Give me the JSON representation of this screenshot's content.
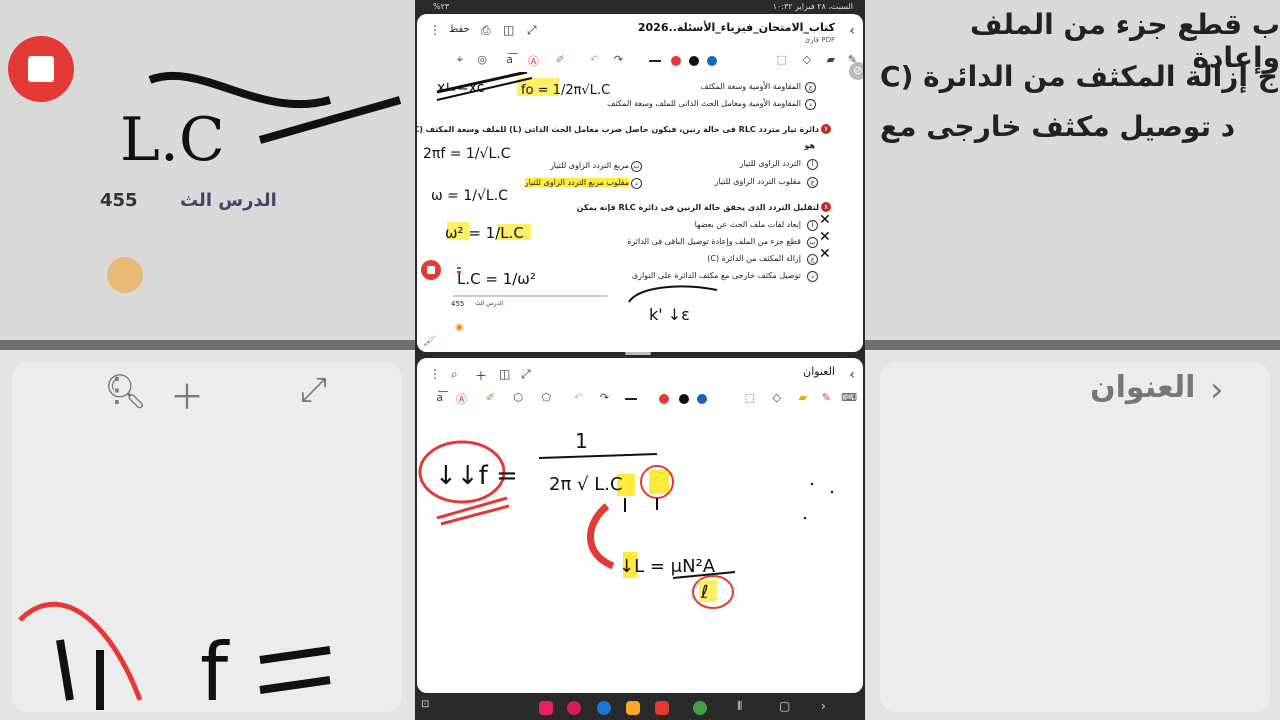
{
  "status": {
    "left": "%٢٣",
    "right": "السبت، ٢٨ فبراير ١٠:٣٢"
  },
  "top_pane": {
    "title": "كتاب_الامتحان_فيزياء_الأسئلة..2026",
    "subtitle": "قارئ PDF",
    "save_label": "حفظ"
  },
  "bottom_pane": {
    "title": "العنوان"
  },
  "doc": {
    "q6_options": [
      "المقاومة الأومية وسعة المكثف",
      "المقاومة الأومية ومعامل الحث الذاتى للملف وسعة المكثف"
    ],
    "q7_number": "٧",
    "q7_text": "دائرة تيار متردد RLC فى حالة رنين، فيكون حاصل ضرب معامل الحث الذاتى (L) للملف وسعة المكثف (C)",
    "q7_suffix": "هو",
    "q7_options": [
      "التردد الزاوى للتيار",
      "مربع التردد الزاوى للتيار",
      "مقلوب التردد الزاوى للتيار",
      "مقلوب مربع التردد الزاوى للتيار"
    ],
    "q8_number": "٨",
    "q8_text": "لتقليل التردد الذى يحقق حالة الرنين فى دائرة RLC فإنه يمكن",
    "q8_options": [
      "إبعاد لفات ملف الحث عن بعضها",
      "قطع جزء من الملف وإعادة توصيل الباقى فى الدائرة",
      "إزالة المكثف من الدائرة (C)",
      "توصيل مكثف خارجى مع مكثف الدائرة على التوازى"
    ],
    "lesson_label": "الدرس الث",
    "lesson_count": "455"
  },
  "background": {
    "big_lines": [
      "ب قطع جزء من الملف وإعادة",
      "ج إزالة المكثف من الدائرة (C",
      "د توصيل مكثف خارجى مع"
    ],
    "title": "العنوان",
    "lesson": "الدرس الث",
    "count": "455"
  },
  "colors": {
    "red": "#e53935",
    "black": "#111111",
    "blue": "#1565c0",
    "highlight": "#ffeb3b"
  }
}
